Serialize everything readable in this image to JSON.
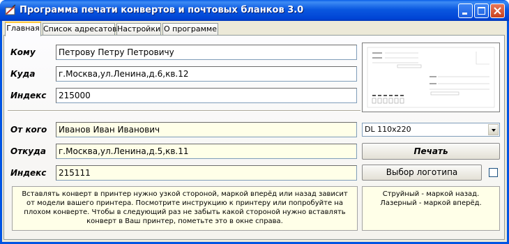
{
  "window": {
    "title": "Программа печати конвертов и почтовых бланков 3.0"
  },
  "tabs": [
    {
      "label": "Главная",
      "active": true
    },
    {
      "label": "Список адресатов",
      "active": false
    },
    {
      "label": "Настройки",
      "active": false
    },
    {
      "label": "О программе",
      "active": false
    }
  ],
  "recipient": {
    "to_label": "Кому",
    "to_value": "Петрову Петру Петровичу",
    "where_label": "Куда",
    "where_value": "г.Москва,ул.Ленина,д.6,кв.12",
    "index_label": "Индекс",
    "index_value": "215000"
  },
  "sender": {
    "from_label": "От кого",
    "from_value": "Иванов Иван Иванович",
    "whence_label": "Откуда",
    "whence_value": "г.Москва,ул.Ленина,д.5,кв.11",
    "index_label": "Индекс",
    "index_value": "215111"
  },
  "envelope_format": {
    "selected": "DL 110x220"
  },
  "buttons": {
    "print": "Печать",
    "choose_logo": "Выбор логотипа"
  },
  "logo_checkbox": {
    "checked": false
  },
  "notes": {
    "instructions": "Вставлять конверт в принтер нужно узкой стороной, маркой вперёд или назад зависит от модели вашего принтера. Посмотрите инструкцию к принтеру или попробуйте на плохом конверте. Чтобы в следующий раз не забыть какой стороной нужно вставлять конверт в Ваш принтер, пометьте это в окне справа.",
    "printer_memo_line1": "Струйный - маркой назад.",
    "printer_memo_line2": "Лазерный - маркой вперёд."
  },
  "colors": {
    "titlebar": "#0054e3",
    "panel": "#ece9d8",
    "sender_field_bg": "#ffffe8",
    "active_tab_accent": "#ffc83c",
    "close_button": "#c9411d"
  }
}
